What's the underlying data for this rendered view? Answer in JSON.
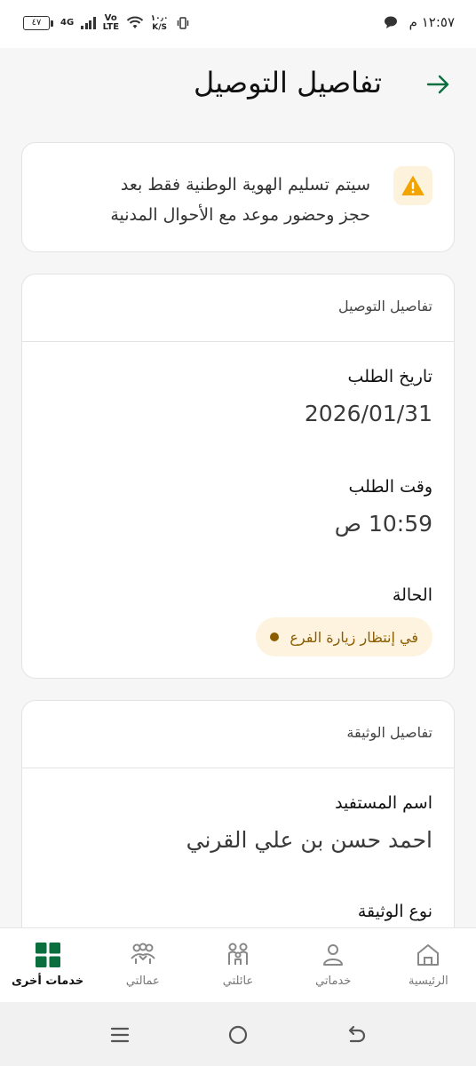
{
  "status_bar": {
    "time": "١٢:٥٧ م",
    "battery": "٤٧",
    "network": "4G",
    "volte": "Vo LTE",
    "speed_value": "١٠٫٠",
    "speed_unit": "K/S"
  },
  "header": {
    "title": "تفاصيل التوصيل",
    "back_icon": "arrow-right-icon",
    "accent": "#0b6e3f"
  },
  "alert": {
    "icon": "warning-icon",
    "icon_color": "#f2a400",
    "line1": "سيتم تسليم الهوية الوطنية فقط بعد",
    "line2": "حجز وحضور موعد مع الأحوال المدنية"
  },
  "delivery": {
    "section_title": "تفاصيل التوصيل",
    "request_date_label": "تاريخ الطلب",
    "request_date": "2026/01/31",
    "request_time_label": "وقت الطلب",
    "request_time": "10:59 ص",
    "status_label": "الحالة",
    "status_value": "في إنتظار زيارة الفرع",
    "status_color": "#8a5d00"
  },
  "document": {
    "section_title": "تفاصيل الوثيقة",
    "beneficiary_label": "اسم المستفيد",
    "beneficiary_name": "احمد حسن بن علي القرني",
    "doc_type_label": "نوع الوثيقة"
  },
  "bottom_nav": {
    "items": [
      {
        "label": "الرئيسية",
        "icon": "home-icon"
      },
      {
        "label": "خدماتي",
        "icon": "person-icon"
      },
      {
        "label": "عائلتي",
        "icon": "family-icon"
      },
      {
        "label": "عمالتي",
        "icon": "workers-icon"
      },
      {
        "label": "خدمات أخرى",
        "icon": "grid-icon",
        "active": true
      }
    ],
    "active_color": "#0b6e3f"
  }
}
